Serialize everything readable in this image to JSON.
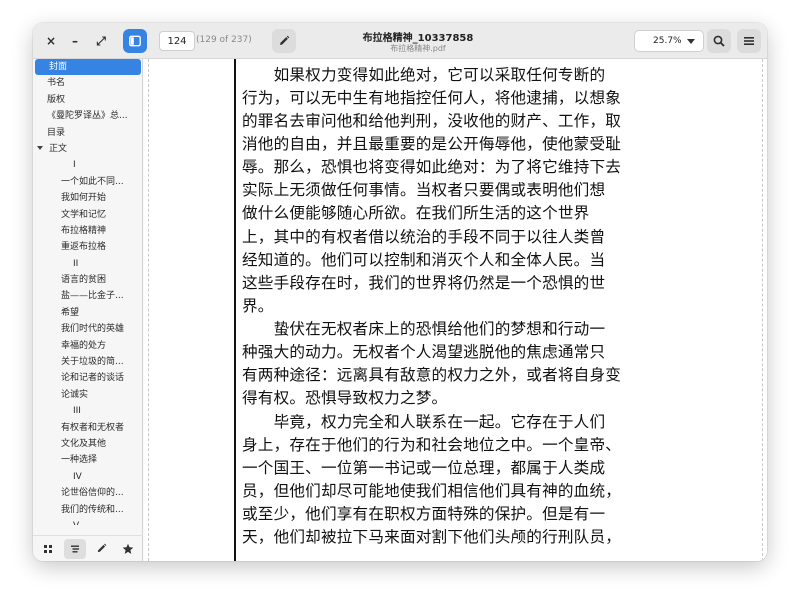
{
  "window": {
    "title": "布拉格精神_10337858",
    "subtitle": "布拉格精神.pdf",
    "controls": {
      "close": "×",
      "minimize": "–",
      "restore": "⤢"
    }
  },
  "toolbar": {
    "page_value": "124",
    "page_count": "(129 of 237)",
    "zoom": "25.7%"
  },
  "outline": [
    {
      "label": "封面",
      "level": 0,
      "selected": true
    },
    {
      "label": "书名",
      "level": 0
    },
    {
      "label": "版权",
      "level": 0
    },
    {
      "label": "《曼陀罗译丛》总...",
      "level": 0
    },
    {
      "label": "目录",
      "level": 0
    },
    {
      "label": "正文",
      "level": 0,
      "expanded": true
    },
    {
      "label": "I",
      "level": 2
    },
    {
      "label": "一个如此不同...",
      "level": 1
    },
    {
      "label": "我如何开始",
      "level": 1
    },
    {
      "label": "文学和记忆",
      "level": 1
    },
    {
      "label": "布拉格精神",
      "level": 1
    },
    {
      "label": "重返布拉格",
      "level": 1
    },
    {
      "label": "II",
      "level": 2
    },
    {
      "label": "语言的贫困",
      "level": 1
    },
    {
      "label": "盐——比金子...",
      "level": 1
    },
    {
      "label": "希望",
      "level": 1
    },
    {
      "label": "我们时代的英雄",
      "level": 1
    },
    {
      "label": "幸福的处方",
      "level": 1
    },
    {
      "label": "关于垃圾的简...",
      "level": 1
    },
    {
      "label": "论和记者的谈话",
      "level": 1
    },
    {
      "label": "论诚实",
      "level": 1
    },
    {
      "label": "III",
      "level": 2
    },
    {
      "label": "有权者和无权者",
      "level": 1
    },
    {
      "label": "文化及其他",
      "level": 1
    },
    {
      "label": "一种选择",
      "level": 1
    },
    {
      "label": "IV",
      "level": 2
    },
    {
      "label": "论世俗信仰的...",
      "level": 1
    },
    {
      "label": "我们的传统和...",
      "level": 1
    },
    {
      "label": "V",
      "level": 2
    }
  ],
  "page_text": [
    "　　如果权力变得如此绝对，它可以采取任何专断的",
    "行为，可以无中生有地指控任何人，将他逮捕，以想象",
    "的罪名去审问他和给他判刑，没收他的财产、工作，取",
    "消他的自由，并且最重要的是公开侮辱他，使他蒙受耻",
    "辱。那么，恐惧也将变得如此绝对：为了将它维持下去",
    "实际上无须做任何事情。当权者只要偶或表明他们想",
    "做什么便能够随心所欲。在我们所生活的这个世界",
    "上，其中的有权者借以统治的手段不同于以往人类曾",
    "经知道的。他们可以控制和消灭个人和全体人民。当",
    "这些手段存在时，我们的世界将仍然是一个恐惧的世",
    "界。",
    "　　蛰伏在无权者床上的恐惧给他们的梦想和行动一",
    "种强大的动力。无权者个人渴望逃脱他的焦虑通常只",
    "有两种途径：远离具有敌意的权力之外，或者将自身变",
    "得有权。恐惧导致权力之梦。",
    "　　毕竟，权力完全和人联系在一起。它存在于人们",
    "身上，存在于他们的行为和社会地位之中。一个皇帝、",
    "一个国王、一位第一书记或一位总理，都属于人类成",
    "员，但他们却尽可能地使我们相信他们具有神的血统，",
    "或至少，他们享有在职权方面特殊的保护。但是有一",
    "天，他们却被拉下马来面对割下他们头颅的行刑队员，"
  ],
  "sidebar_tabs": [
    "grid",
    "outline",
    "annotations",
    "bookmarks"
  ]
}
